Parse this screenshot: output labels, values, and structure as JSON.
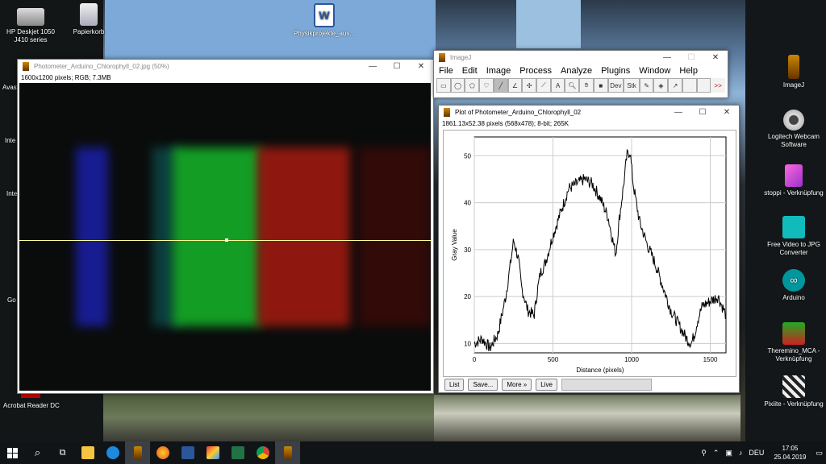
{
  "desktop": {
    "icons_left": [
      {
        "label": "HP Deskjet 1050 J410 series",
        "icon": "printer-icon"
      },
      {
        "label": "Papierkorb",
        "icon": "recycle-bin-icon"
      }
    ],
    "icon_top_center": {
      "label": "Physikprojekte_aus...",
      "icon": "word-document-icon"
    },
    "partial_labels": [
      "Avast",
      "Inte",
      "Inte",
      "Go"
    ],
    "acrobat_label": "Acrobat Reader DC",
    "icons_right": [
      {
        "label": "ImageJ",
        "icon": "microscope-icon"
      },
      {
        "label": "Logitech Webcam Software",
        "icon": "webcam-icon"
      },
      {
        "label": "stoppi - Verknüpfung",
        "icon": "shortcut-icon"
      },
      {
        "label": "Free Video to JPG Converter",
        "icon": "jpg-converter-icon"
      },
      {
        "label": "Arduino",
        "icon": "arduino-icon"
      },
      {
        "label": "Theremino_MCA - Verknüpfung",
        "icon": "theremino-icon"
      },
      {
        "label": "Pixiite - Verknüpfung",
        "icon": "pixiite-icon"
      }
    ]
  },
  "image_window": {
    "title": "Photometer_Arduino_Chlorophyll_02.jpg (50%)",
    "info": "1600x1200 pixels; RGB; 7.3MB"
  },
  "imagej_window": {
    "title": "ImageJ",
    "menu": [
      "File",
      "Edit",
      "Image",
      "Process",
      "Analyze",
      "Plugins",
      "Window",
      "Help"
    ],
    "tools": [
      "rectangle-tool",
      "oval-tool",
      "polygon-tool",
      "freehand-tool",
      "line-tool",
      "angle-tool",
      "point-tool",
      "wand-tool",
      "text-tool",
      "magnifier-tool",
      "hand-tool",
      "color-picker-tool",
      "developer-menu",
      "stacks-menu",
      "pencil-tool",
      "brush-tool",
      "flood-fill-tool",
      "arrow-tool"
    ],
    "tool_labels": {
      "dev": "Dev",
      "stk": "Stk",
      "more": ">>"
    }
  },
  "plot_window": {
    "title": "Plot of Photometer_Arduino_Chlorophyll_02",
    "info": "1861.13x52.38 pixels (568x478); 8-bit; 265K",
    "buttons": {
      "list": "List",
      "save": "Save...",
      "more": "More »",
      "live": "Live"
    }
  },
  "chart_data": {
    "type": "line",
    "xlabel": "Distance (pixels)",
    "ylabel": "Gray Value",
    "xlim": [
      0,
      1600
    ],
    "ylim": [
      8,
      54
    ],
    "xticks": [
      0,
      500,
      1000,
      1500
    ],
    "yticks": [
      10,
      20,
      30,
      40,
      50
    ],
    "grid": true,
    "series": [
      {
        "x": [
          0,
          50,
          100,
          150,
          200,
          230,
          250,
          280,
          300,
          340,
          380,
          400,
          420,
          450,
          500,
          550,
          600,
          650,
          700,
          750,
          800,
          850,
          880,
          900,
          920,
          950,
          970,
          990,
          1010,
          1050,
          1100,
          1150,
          1200,
          1250,
          1300,
          1350,
          1380,
          1400,
          1420,
          1450,
          1500,
          1550,
          1600
        ],
        "y": [
          10,
          11,
          9,
          12,
          20,
          27,
          32,
          28,
          22,
          17,
          16,
          21,
          25,
          27,
          33,
          38,
          43,
          44,
          45,
          44,
          41,
          37,
          32,
          29,
          36,
          44,
          50,
          51,
          44,
          36,
          31,
          27,
          22,
          17,
          14,
          11,
          10,
          12,
          15,
          18,
          19,
          20,
          16
        ]
      }
    ]
  },
  "taskbar": {
    "items": [
      "start-icon",
      "search-icon",
      "task-view-icon",
      "file-explorer-icon",
      "edge-icon",
      "imagej-taskbar-icon",
      "firefox-icon",
      "word-icon",
      "paint-icon",
      "excel-icon",
      "chrome-icon",
      "imagej2-taskbar-icon"
    ],
    "lang": "DEU",
    "time": "17:05",
    "date": "25.04.2019"
  },
  "colors": {
    "accent": "#0078d7",
    "plot_line": "#000000",
    "scan_line": "#ffff99"
  }
}
